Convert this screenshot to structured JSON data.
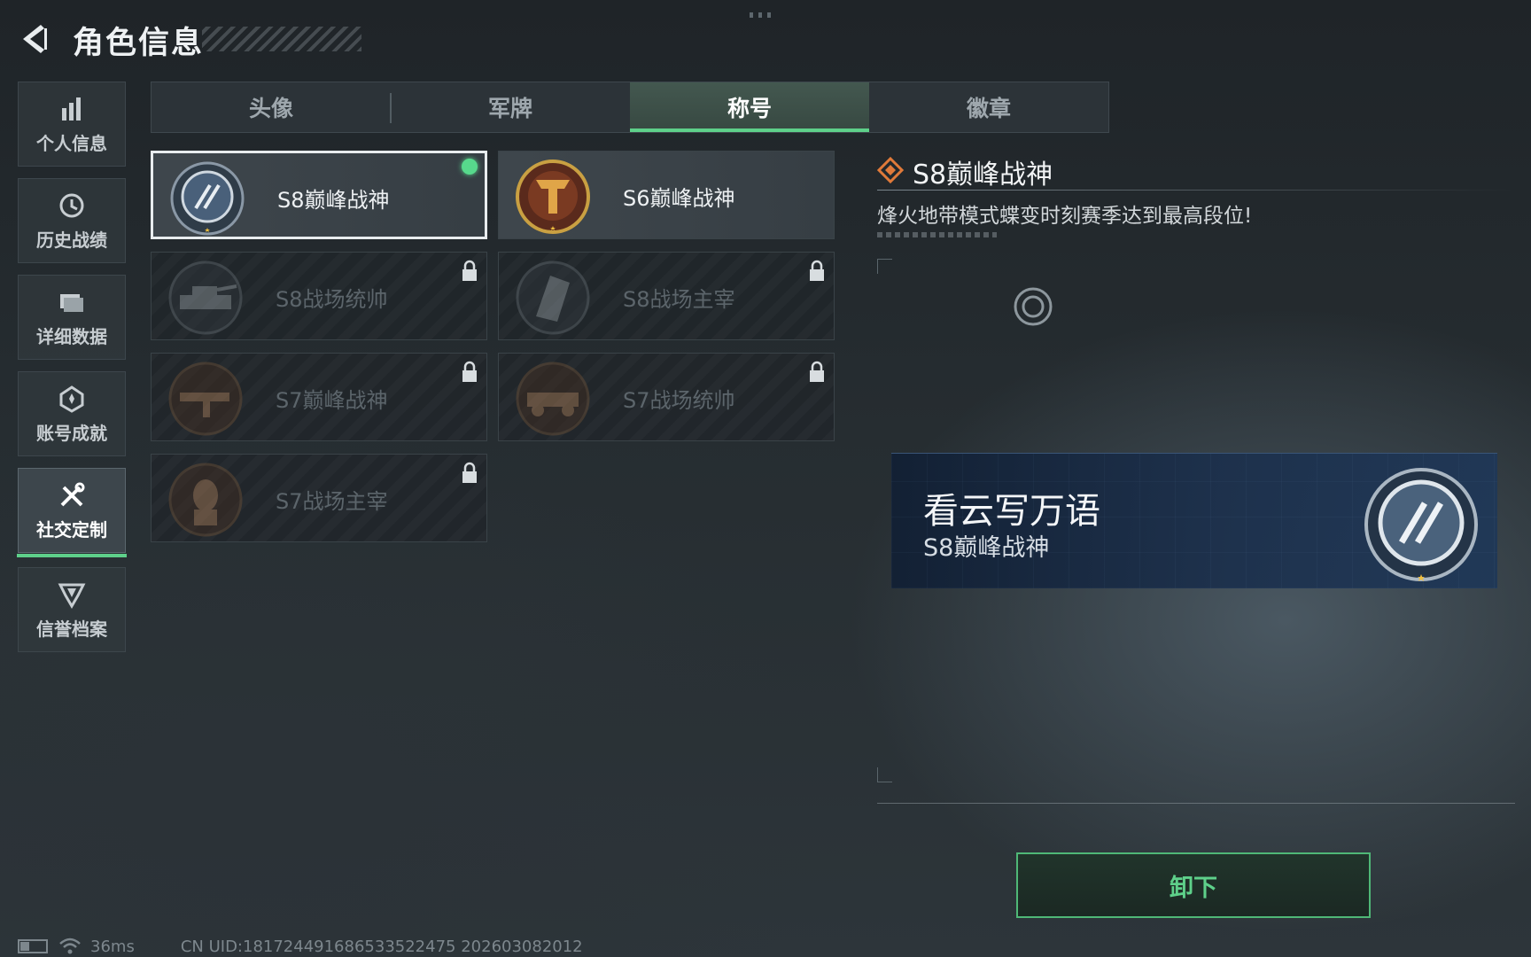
{
  "header": {
    "title": "角色信息"
  },
  "nav": {
    "items": [
      {
        "label": "个人信息",
        "icon": "bar-chart-icon"
      },
      {
        "label": "历史战绩",
        "icon": "history-clock-icon"
      },
      {
        "label": "详细数据",
        "icon": "folder-icon"
      },
      {
        "label": "账号成就",
        "icon": "medal-icon"
      },
      {
        "label": "社交定制",
        "icon": "tools-icon",
        "active": true
      },
      {
        "label": "信誉档案",
        "icon": "shield-emblem-icon"
      }
    ]
  },
  "tabs": [
    {
      "label": "头像"
    },
    {
      "label": "军牌"
    },
    {
      "label": "称号",
      "active": true
    },
    {
      "label": "徽章"
    }
  ],
  "titles": [
    {
      "name": "S8巅峰战神",
      "locked": false,
      "equipped": true,
      "icon": "s8-peak-badge-icon"
    },
    {
      "name": "S6巅峰战神",
      "locked": false,
      "equipped": false,
      "icon": "s6-peak-badge-icon"
    },
    {
      "name": "S8战场统帅",
      "locked": true,
      "icon": "tank-badge-icon"
    },
    {
      "name": "S8战场主宰",
      "locked": true,
      "icon": "building-badge-icon"
    },
    {
      "name": "S7巅峰战神",
      "locked": true,
      "icon": "gun-badge-icon"
    },
    {
      "name": "S7战场统帅",
      "locked": true,
      "icon": "vehicle-badge-icon"
    },
    {
      "name": "S7战场主宰",
      "locked": true,
      "icon": "soldier-badge-icon"
    }
  ],
  "detail": {
    "title": "S8巅峰战神",
    "description": "烽火地带模式蝶变时刻赛季达到最高段位!"
  },
  "preview": {
    "player_name": "看云写万语",
    "title": "S8巅峰战神"
  },
  "actions": {
    "unequip_label": "卸下"
  },
  "status": {
    "ping": "36ms",
    "uid": "CN UID:18172449168653352247​5 202603082012"
  },
  "colors": {
    "accent": "#5ed08a",
    "equipped_dot": "#57d98c",
    "detail_icon": "#e07a3a"
  }
}
